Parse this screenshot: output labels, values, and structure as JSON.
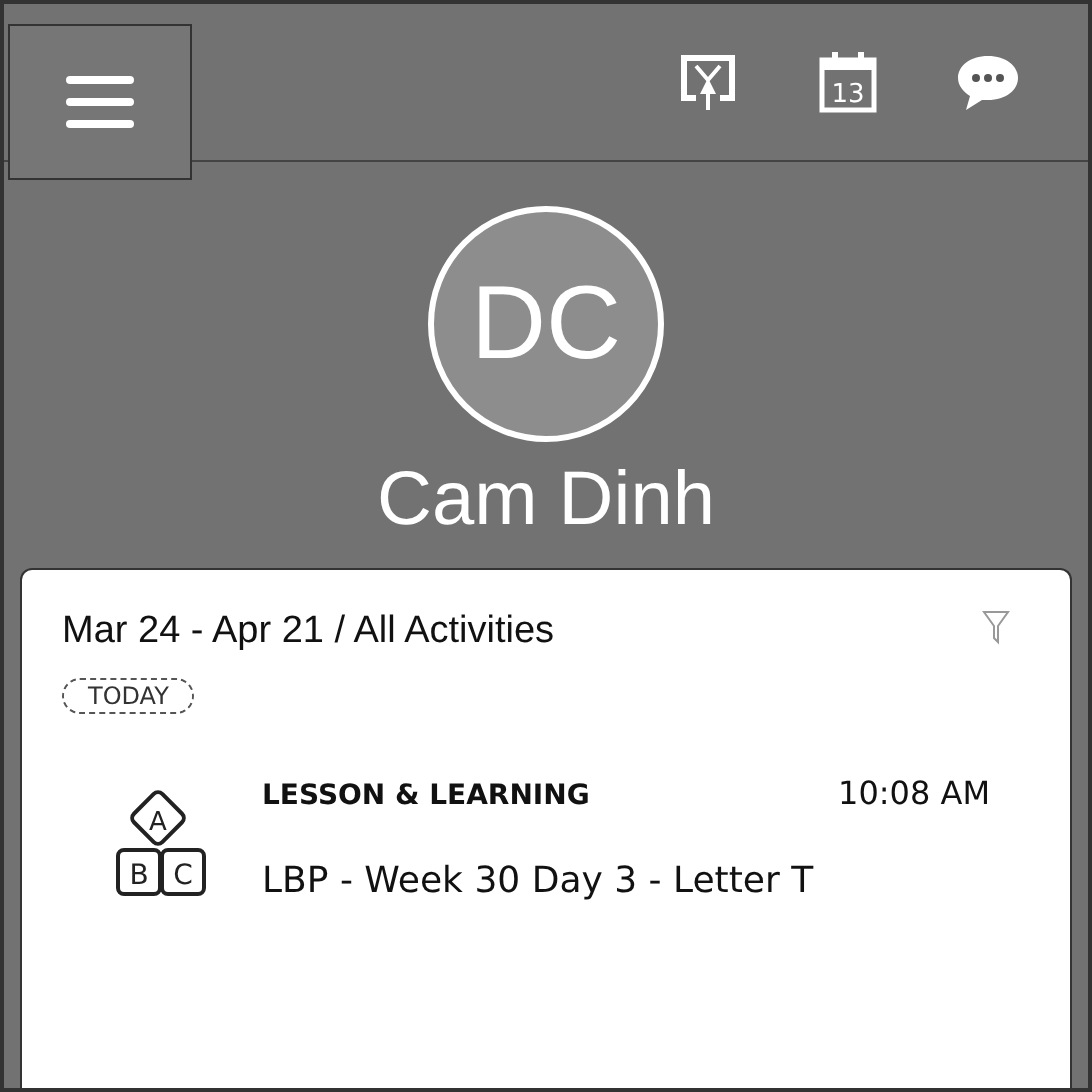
{
  "top_bar": {
    "calendar_day": "13"
  },
  "profile": {
    "initials": "DC",
    "name": "Cam Dinh"
  },
  "feed": {
    "range_title": "Mar 24 - Apr 21 / All Activities",
    "day_label": "TODAY",
    "activities": [
      {
        "kind": "lesson",
        "icon_letters": [
          "A",
          "B",
          "C"
        ],
        "category": "LESSON & LEARNING",
        "time": "10:08 AM",
        "description": "LBP - Week 30 Day 3 - Letter T"
      }
    ]
  }
}
